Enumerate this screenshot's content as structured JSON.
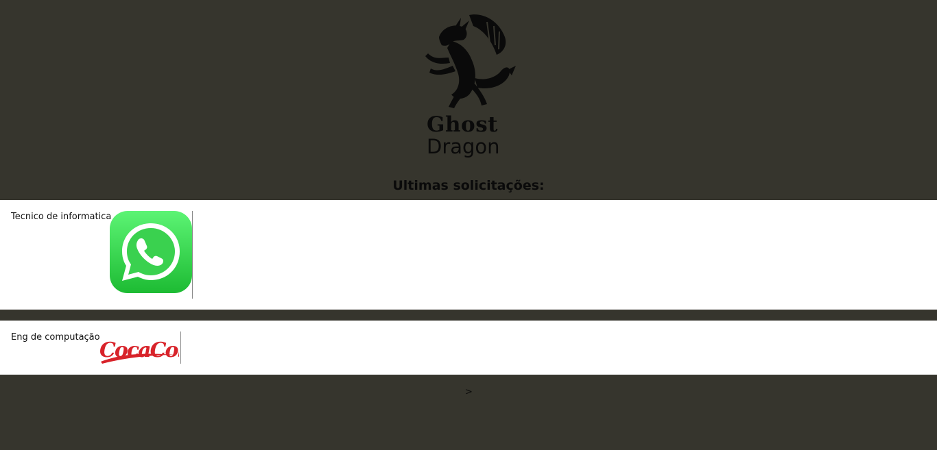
{
  "brand": {
    "line1": "Ghost",
    "line2": "Dragon"
  },
  "section": {
    "title": "Ultimas solicitações:"
  },
  "requests": [
    {
      "title": "Tecnico de informatica",
      "company_logo": "whatsapp-logo"
    },
    {
      "title": "Eng de computação",
      "company_logo": "coca-cola-logo"
    }
  ],
  "pagination": {
    "next_label": ">"
  },
  "colors": {
    "background": "#36352d",
    "card": "#ffffff",
    "whatsapp_green": "#2fc94a",
    "coca_cola_red": "#d8232a"
  }
}
